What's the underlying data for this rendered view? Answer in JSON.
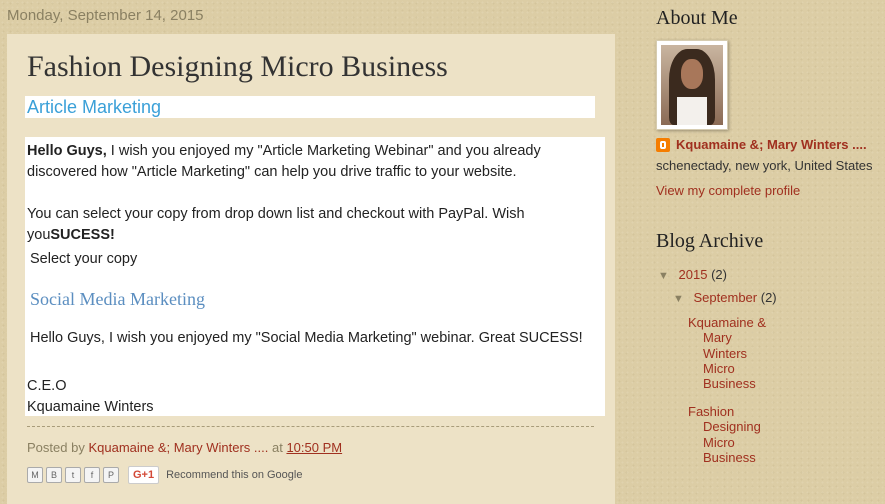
{
  "post": {
    "date": "Monday, September 14, 2015",
    "title": "Fashion Designing Micro Business",
    "section_heading": "Article Marketing",
    "greeting_bold": "Hello Guys,",
    "para1_line1_rest": " I wish you enjoyed my \"Article Marketing Webinar\" and you already",
    "para1_line2": "discovered how \"Article Marketing\" can help you drive traffic to your website.",
    "para2_line1": "You can select your copy from drop down list and checkout with PayPal. Wish",
    "para2_line2_prefix": "you",
    "para2_line2_bold": "SUCESS!",
    "select_label": "Select your copy",
    "smm_heading": "Social Media Marketing",
    "smm_text": "Hello Guys, I wish you enjoyed my \"Social Media Marketing\" webinar. Great SUCESS!",
    "sign_title": "C.E.O",
    "sign_name": "Kquamaine Winters",
    "footer_posted_by": "Posted by",
    "footer_author": "Kquamaine &; Mary Winters ....",
    "footer_at": "at",
    "footer_time": "10:50 PM",
    "share_buttons": [
      "M",
      "B",
      "t",
      "f",
      "P"
    ],
    "gplus_label": "G+1",
    "recommend_text": "Recommend this on Google"
  },
  "sidebar": {
    "about_title": "About Me",
    "profile_name": "Kquamaine &; Mary Winters ....",
    "location": "schenectady, new york, United States",
    "profile_link": "View my complete profile",
    "archive_title": "Blog Archive",
    "archive": {
      "year": "2015",
      "year_count": "(2)",
      "month": "September",
      "month_count": "(2)",
      "posts": [
        [
          "Kquamaine &",
          "Mary",
          "Winters",
          "Micro",
          "Business"
        ],
        [
          "Fashion",
          "Designing",
          "Micro",
          "Business"
        ]
      ]
    }
  },
  "colors": {
    "background": "#dccda5",
    "post_bg": "#ede2c6",
    "link": "#a0301f",
    "accent_blue": "#3aa0d8",
    "heading_blue": "#5b8ec0"
  },
  "icons": [
    "email-icon",
    "blogger-icon",
    "twitter-icon",
    "facebook-icon",
    "pinterest-icon",
    "triangle-down-icon"
  ]
}
